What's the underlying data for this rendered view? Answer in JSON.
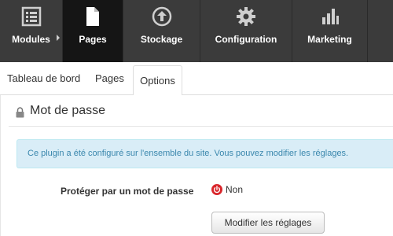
{
  "nav": {
    "items": [
      {
        "label": "Modules",
        "icon": "modules-icon"
      },
      {
        "label": "Pages",
        "icon": "pages-icon",
        "active": true
      },
      {
        "label": "Stockage",
        "icon": "upload-icon"
      },
      {
        "label": "Configuration",
        "icon": "gear-icon"
      },
      {
        "label": "Marketing",
        "icon": "bar-chart-icon"
      }
    ]
  },
  "tabs": [
    {
      "label": "Tableau de bord"
    },
    {
      "label": "Pages"
    },
    {
      "label": "Options",
      "active": true
    }
  ],
  "panel": {
    "title": "Mot de passe",
    "icon": "lock-icon",
    "alert": "Ce plugin a été configuré sur l'ensemble du site. Vous pouvez modifier les réglages.",
    "field_label": "Protéger par un mot de passe",
    "status_value": "Non",
    "status_icon": "power-icon",
    "button_label": "Modifier les réglages"
  },
  "colors": {
    "nav_bg": "#3b3b3b",
    "nav_active_bg": "#151515",
    "alert_bg": "#d9edf7",
    "alert_text": "#3a87ad",
    "status_red": "#d9262b"
  }
}
